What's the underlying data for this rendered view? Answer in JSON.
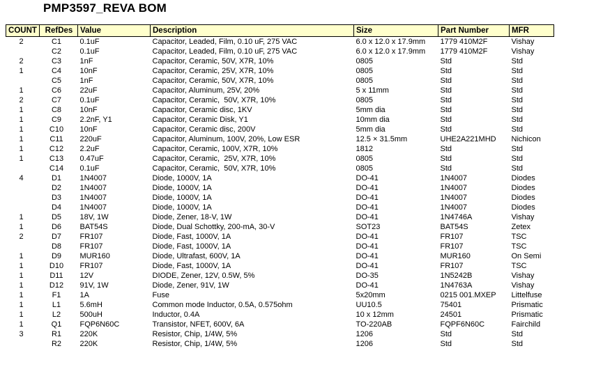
{
  "document": {
    "title": "PMP3597_REVA BOM"
  },
  "table": {
    "columns": [
      {
        "key": "count",
        "label": "COUNT"
      },
      {
        "key": "refdes",
        "label": "RefDes"
      },
      {
        "key": "value",
        "label": "Value"
      },
      {
        "key": "desc",
        "label": "Description"
      },
      {
        "key": "size",
        "label": "Size"
      },
      {
        "key": "part",
        "label": "Part Number"
      },
      {
        "key": "mfr",
        "label": "MFR"
      }
    ],
    "header_background": "#FFFFCC",
    "border_color": "#000000",
    "rows": [
      {
        "count": "2",
        "refdes": "C1",
        "value": "0.1uF",
        "desc": "Capacitor, Leaded, Film, 0.10 uF, 275 VAC",
        "size": "6.0 x 12.0 x 17.9mm",
        "part": "1779 410M2F",
        "mfr": "Vishay"
      },
      {
        "count": "",
        "refdes": "C2",
        "value": "0.1uF",
        "desc": "Capacitor, Leaded, Film, 0.10 uF, 275 VAC",
        "size": "6.0 x 12.0 x 17.9mm",
        "part": "1779 410M2F",
        "mfr": "Vishay"
      },
      {
        "count": "2",
        "refdes": "C3",
        "value": "1nF",
        "desc": "Capacitor, Ceramic, 50V, X7R, 10%",
        "size": "0805",
        "part": "Std",
        "mfr": "Std"
      },
      {
        "count": "1",
        "refdes": "C4",
        "value": "10nF",
        "desc": "Capacitor, Ceramic, 25V, X7R, 10%",
        "size": "0805",
        "part": "Std",
        "mfr": "Std"
      },
      {
        "count": "",
        "refdes": "C5",
        "value": "1nF",
        "desc": "Capacitor, Ceramic, 50V, X7R, 10%",
        "size": "0805",
        "part": "Std",
        "mfr": "Std"
      },
      {
        "count": "1",
        "refdes": "C6",
        "value": "22uF",
        "desc": "Capacitor, Aluminum, 25V, 20%",
        "size": "5 x 11mm",
        "part": "Std",
        "mfr": "Std"
      },
      {
        "count": "2",
        "refdes": "C7",
        "value": "0.1uF",
        "desc": "Capacitor, Ceramic,  50V, X7R, 10%",
        "size": "0805",
        "part": "Std",
        "mfr": "Std"
      },
      {
        "count": "1",
        "refdes": "C8",
        "value": "10nF",
        "desc": "Capacitor, Ceramic disc, 1KV",
        "size": "5mm dia",
        "part": "Std",
        "mfr": "Std"
      },
      {
        "count": "1",
        "refdes": "C9",
        "value": "2.2nF, Y1",
        "desc": "Capacitor, Ceramic Disk, Y1",
        "size": "10mm dia",
        "part": "Std",
        "mfr": "Std"
      },
      {
        "count": "1",
        "refdes": "C10",
        "value": "10nF",
        "desc": "Capacitor, Ceramic disc, 200V",
        "size": "5mm dia",
        "part": "Std",
        "mfr": "Std"
      },
      {
        "count": "1",
        "refdes": "C11",
        "value": "220uF",
        "desc": "Capacitor, Aluminum, 100V, 20%, Low ESR",
        "size": "12.5 × 31.5mm",
        "part": "UHE2A221MHD",
        "mfr": "Nichicon"
      },
      {
        "count": "1",
        "refdes": "C12",
        "value": "2.2uF",
        "desc": "Capacitor, Ceramic, 100V, X7R, 10%",
        "size": "1812",
        "part": "Std",
        "mfr": "Std"
      },
      {
        "count": "1",
        "refdes": "C13",
        "value": "0.47uF",
        "desc": "Capacitor, Ceramic,  25V, X7R, 10%",
        "size": "0805",
        "part": "Std",
        "mfr": "Std"
      },
      {
        "count": "",
        "refdes": "C14",
        "value": "0.1uF",
        "desc": "Capacitor, Ceramic,  50V, X7R, 10%",
        "size": "0805",
        "part": "Std",
        "mfr": "Std"
      },
      {
        "count": "4",
        "refdes": "D1",
        "value": "1N4007",
        "desc": "Diode, 1000V, 1A",
        "size": "DO-41",
        "part": "1N4007",
        "mfr": "Diodes"
      },
      {
        "count": "",
        "refdes": "D2",
        "value": "1N4007",
        "desc": "Diode, 1000V, 1A",
        "size": "DO-41",
        "part": "1N4007",
        "mfr": "Diodes"
      },
      {
        "count": "",
        "refdes": "D3",
        "value": "1N4007",
        "desc": "Diode, 1000V, 1A",
        "size": "DO-41",
        "part": "1N4007",
        "mfr": "Diodes"
      },
      {
        "count": "",
        "refdes": "D4",
        "value": "1N4007",
        "desc": "Diode, 1000V, 1A",
        "size": "DO-41",
        "part": "1N4007",
        "mfr": "Diodes"
      },
      {
        "count": "1",
        "refdes": "D5",
        "value": "18V, 1W",
        "desc": "Diode, Zener, 18-V, 1W",
        "size": "DO-41",
        "part": "1N4746A",
        "mfr": "Vishay"
      },
      {
        "count": "1",
        "refdes": "D6",
        "value": "BAT54S",
        "desc": "Diode, Dual Schottky, 200-mA, 30-V",
        "size": "SOT23",
        "part": "BAT54S",
        "mfr": "Zetex"
      },
      {
        "count": "2",
        "refdes": "D7",
        "value": "FR107",
        "desc": "Diode, Fast, 1000V, 1A",
        "size": "DO-41",
        "part": "FR107",
        "mfr": "TSC"
      },
      {
        "count": "",
        "refdes": "D8",
        "value": "FR107",
        "desc": "Diode, Fast, 1000V, 1A",
        "size": "DO-41",
        "part": "FR107",
        "mfr": "TSC"
      },
      {
        "count": "1",
        "refdes": "D9",
        "value": "MUR160",
        "desc": "Diode, Ultrafast, 600V, 1A",
        "size": "DO-41",
        "part": "MUR160",
        "mfr": "On Semi"
      },
      {
        "count": "1",
        "refdes": "D10",
        "value": "FR107",
        "desc": "Diode, Fast, 1000V, 1A",
        "size": "DO-41",
        "part": "FR107",
        "mfr": "TSC"
      },
      {
        "count": "1",
        "refdes": "D11",
        "value": "12V",
        "desc": "DIODE, Zener, 12V, 0.5W, 5%",
        "size": "DO-35",
        "part": "1N5242B",
        "mfr": "Vishay"
      },
      {
        "count": "1",
        "refdes": "D12",
        "value": "91V, 1W",
        "desc": "Diode, Zener, 91V, 1W",
        "size": "DO-41",
        "part": "1N4763A",
        "mfr": "Vishay"
      },
      {
        "count": "1",
        "refdes": "F1",
        "value": "1A",
        "desc": "Fuse",
        "size": "5x20mm",
        "part": "0215 001.MXEP",
        "mfr": "Littelfuse"
      },
      {
        "count": "1",
        "refdes": "L1",
        "value": "5.6mH",
        "desc": "Common mode Inductor, 0.5A, 0.575ohm",
        "size": "UU10.5",
        "part": "75401",
        "mfr": "Prismatic"
      },
      {
        "count": "1",
        "refdes": "L2",
        "value": "500uH",
        "desc": "Inductor, 0.4A",
        "size": "10 x 12mm",
        "part": "24501",
        "mfr": "Prismatic"
      },
      {
        "count": "1",
        "refdes": "Q1",
        "value": "FQP6N60C",
        "desc": "Transistor, NFET, 600V, 6A",
        "size": "TO-220AB",
        "part": "FQPF6N60C",
        "mfr": "Fairchild"
      },
      {
        "count": "3",
        "refdes": "R1",
        "value": "220K",
        "desc": "Resistor, Chip, 1/4W, 5%",
        "size": "1206",
        "part": "Std",
        "mfr": "Std"
      },
      {
        "count": "",
        "refdes": "R2",
        "value": "220K",
        "desc": "Resistor, Chip, 1/4W, 5%",
        "size": "1206",
        "part": "Std",
        "mfr": "Std"
      }
    ]
  }
}
